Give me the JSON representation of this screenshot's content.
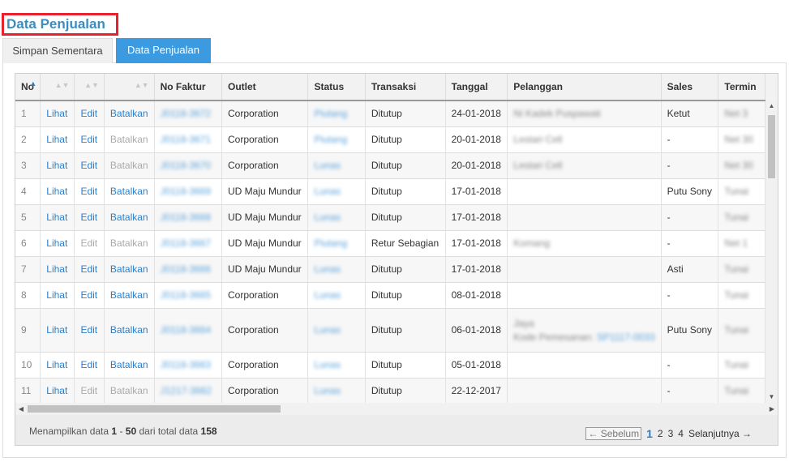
{
  "page": {
    "title": "Data Penjualan"
  },
  "tabs": [
    {
      "label": "Simpan Sementara",
      "active": false
    },
    {
      "label": "Data Penjualan",
      "active": true
    }
  ],
  "table": {
    "headers": [
      "No",
      "",
      "",
      "",
      "No Faktur",
      "Outlet",
      "Status",
      "Transaksi",
      "Tanggal",
      "Pelanggan",
      "Sales",
      "Termin"
    ],
    "action_labels": {
      "view": "Lihat",
      "edit": "Edit",
      "cancel": "Batalkan"
    },
    "rows": [
      {
        "no": "1",
        "edit_enabled": true,
        "cancel_enabled": true,
        "faktur": "J0118-3672",
        "outlet": "Corporation",
        "status": "Piutang",
        "transaksi": "Ditutup",
        "tanggal": "24-01-2018",
        "pelanggan": "Ni Kadek Puspawati",
        "pelanggan2": "",
        "pelanggan2_link": "",
        "sales": "Ketut",
        "termin": "Net 3"
      },
      {
        "no": "2",
        "edit_enabled": true,
        "cancel_enabled": false,
        "faktur": "J0118-3671",
        "outlet": "Corporation",
        "status": "Piutang",
        "transaksi": "Ditutup",
        "tanggal": "20-01-2018",
        "pelanggan": "Lestari Cell",
        "pelanggan2": "",
        "pelanggan2_link": "",
        "sales": "-",
        "termin": "Net 30"
      },
      {
        "no": "3",
        "edit_enabled": true,
        "cancel_enabled": false,
        "faktur": "J0118-3670",
        "outlet": "Corporation",
        "status": "Lunas",
        "transaksi": "Ditutup",
        "tanggal": "20-01-2018",
        "pelanggan": "Lestari Cell",
        "pelanggan2": "",
        "pelanggan2_link": "",
        "sales": "-",
        "termin": "Net 30"
      },
      {
        "no": "4",
        "edit_enabled": true,
        "cancel_enabled": true,
        "faktur": "J0118-3669",
        "outlet": "UD Maju Mundur",
        "status": "Lunas",
        "transaksi": "Ditutup",
        "tanggal": "17-01-2018",
        "pelanggan": "",
        "pelanggan2": "",
        "pelanggan2_link": "",
        "sales": "Putu Sony",
        "termin": "Tunai"
      },
      {
        "no": "5",
        "edit_enabled": true,
        "cancel_enabled": true,
        "faktur": "J0118-3668",
        "outlet": "UD Maju Mundur",
        "status": "Lunas",
        "transaksi": "Ditutup",
        "tanggal": "17-01-2018",
        "pelanggan": "",
        "pelanggan2": "",
        "pelanggan2_link": "",
        "sales": "-",
        "termin": "Tunai"
      },
      {
        "no": "6",
        "edit_enabled": false,
        "cancel_enabled": false,
        "faktur": "J0118-3667",
        "outlet": "UD Maju Mundur",
        "status": "Piutang",
        "transaksi": "Retur Sebagian",
        "tanggal": "17-01-2018",
        "pelanggan": "Komang",
        "pelanggan2": "",
        "pelanggan2_link": "",
        "sales": "-",
        "termin": "Net 1"
      },
      {
        "no": "7",
        "edit_enabled": true,
        "cancel_enabled": true,
        "faktur": "J0118-3666",
        "outlet": "UD Maju Mundur",
        "status": "Lunas",
        "transaksi": "Ditutup",
        "tanggal": "17-01-2018",
        "pelanggan": "",
        "pelanggan2": "",
        "pelanggan2_link": "",
        "sales": "Asti",
        "termin": "Tunai"
      },
      {
        "no": "8",
        "edit_enabled": true,
        "cancel_enabled": true,
        "faktur": "J0118-3665",
        "outlet": "Corporation",
        "status": "Lunas",
        "transaksi": "Ditutup",
        "tanggal": "08-01-2018",
        "pelanggan": "",
        "pelanggan2": "",
        "pelanggan2_link": "",
        "sales": "-",
        "termin": "Tunai"
      },
      {
        "no": "9",
        "edit_enabled": true,
        "cancel_enabled": true,
        "faktur": "J0118-3664",
        "outlet": "Corporation",
        "status": "Lunas",
        "transaksi": "Ditutup",
        "tanggal": "06-01-2018",
        "pelanggan": "Jaya",
        "pelanggan2": "Kode Pemesanan:",
        "pelanggan2_link": "SP1117-0033",
        "sales": "Putu Sony",
        "termin": "Tunai",
        "tall": true
      },
      {
        "no": "10",
        "edit_enabled": true,
        "cancel_enabled": true,
        "faktur": "J0118-3663",
        "outlet": "Corporation",
        "status": "Lunas",
        "transaksi": "Ditutup",
        "tanggal": "05-01-2018",
        "pelanggan": "",
        "pelanggan2": "",
        "pelanggan2_link": "",
        "sales": "-",
        "termin": "Tunai"
      },
      {
        "no": "11",
        "edit_enabled": false,
        "cancel_enabled": false,
        "faktur": "J1217-3662",
        "outlet": "Corporation",
        "status": "Lunas",
        "transaksi": "Ditutup",
        "tanggal": "22-12-2017",
        "pelanggan": "",
        "pelanggan2": "",
        "pelanggan2_link": "",
        "sales": "-",
        "termin": "Tunai"
      }
    ]
  },
  "footer": {
    "prefix": "Menampilkan data",
    "from": "1",
    "sep": "-",
    "to": "50",
    "middle": "dari total data",
    "total": "158"
  },
  "pagination": {
    "prev": "← Sebelum",
    "pages": [
      "1",
      "2",
      "3",
      "4"
    ],
    "current": "1",
    "next": "Selanjutnya →"
  },
  "colors": {
    "accent": "#3c9be0",
    "link": "#2a7fc9",
    "highlight_border": "#e8212e"
  }
}
